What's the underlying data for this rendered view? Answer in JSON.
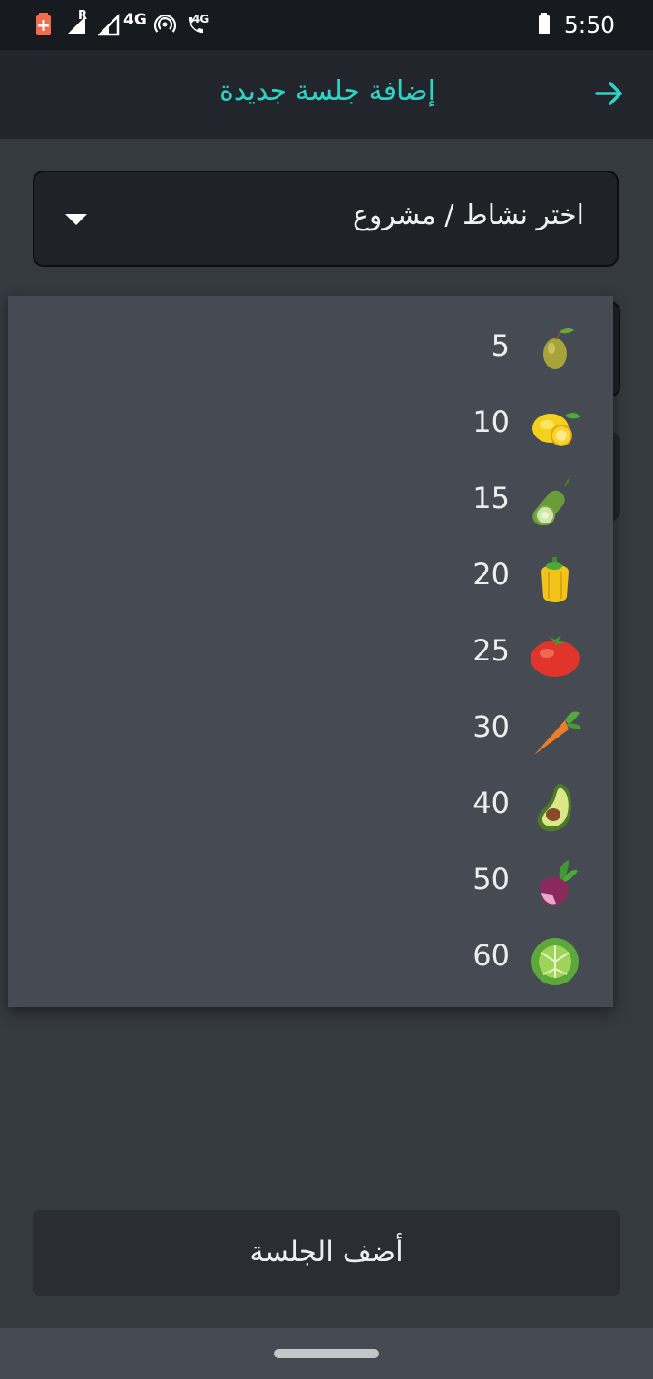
{
  "status_bar": {
    "time": "5:50",
    "network_label": "4G",
    "call_network_label": "4G",
    "roaming_label": "R",
    "icons": [
      "battery-saver-icon",
      "signal-roaming-icon",
      "signal-icon",
      "hotspot-icon",
      "wifi-calling-icon",
      "battery-icon"
    ]
  },
  "app_bar": {
    "title": "إضافة جلسة جديدة",
    "back_icon": "arrow-right-icon",
    "accent_color": "#2ed3c4"
  },
  "activity_spinner": {
    "placeholder": "اختر نشاط / مشروع",
    "icon": "dropdown-arrow-icon"
  },
  "duration_dropdown": {
    "options": [
      {
        "label": "5",
        "icon": "olive-icon"
      },
      {
        "label": "10",
        "icon": "lemon-icon"
      },
      {
        "label": "15",
        "icon": "cucumber-icon"
      },
      {
        "label": "20",
        "icon": "pepper-icon"
      },
      {
        "label": "25",
        "icon": "tomato-icon"
      },
      {
        "label": "30",
        "icon": "carrot-icon"
      },
      {
        "label": "40",
        "icon": "avocado-icon"
      },
      {
        "label": "50",
        "icon": "beet-icon"
      },
      {
        "label": "60",
        "icon": "cabbage-icon"
      }
    ]
  },
  "add_session_button": {
    "label": "أضف الجلسة"
  }
}
